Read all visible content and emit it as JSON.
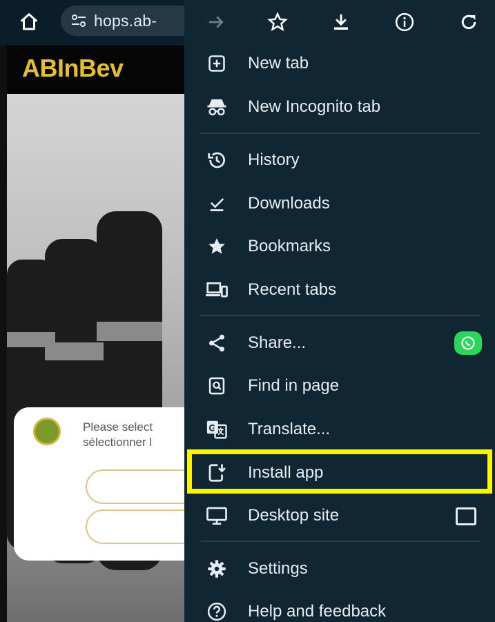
{
  "browser": {
    "url": "hops.ab-"
  },
  "page": {
    "brand": "ABInBev",
    "modal_text_line1": "Please select",
    "modal_text_line2": "sélectionner l"
  },
  "menu": {
    "toolbar_icons": [
      "forward-icon",
      "star-icon",
      "download-icon",
      "info-icon",
      "refresh-icon"
    ],
    "items": [
      {
        "label": "New tab",
        "icon": "new-tab-icon"
      },
      {
        "label": "New Incognito tab",
        "icon": "incognito-icon"
      },
      {
        "label": "History",
        "icon": "history-icon"
      },
      {
        "label": "Downloads",
        "icon": "downloads-icon"
      },
      {
        "label": "Bookmarks",
        "icon": "star-filled-icon"
      },
      {
        "label": "Recent tabs",
        "icon": "devices-icon"
      },
      {
        "label": "Share...",
        "icon": "share-icon"
      },
      {
        "label": "Find in page",
        "icon": "find-icon"
      },
      {
        "label": "Translate...",
        "icon": "translate-icon"
      },
      {
        "label": "Install app",
        "icon": "install-app-icon"
      },
      {
        "label": "Desktop site",
        "icon": "desktop-icon"
      },
      {
        "label": "Settings",
        "icon": "gear-icon"
      },
      {
        "label": "Help and feedback",
        "icon": "help-icon"
      }
    ],
    "highlighted_item": "Install app",
    "desktop_site_checked": false
  },
  "colors": {
    "menu_bg": "#102733",
    "highlight": "#fbf400",
    "brand_gold": "#e6bf2e",
    "whatsapp_green": "#2bd65a"
  }
}
